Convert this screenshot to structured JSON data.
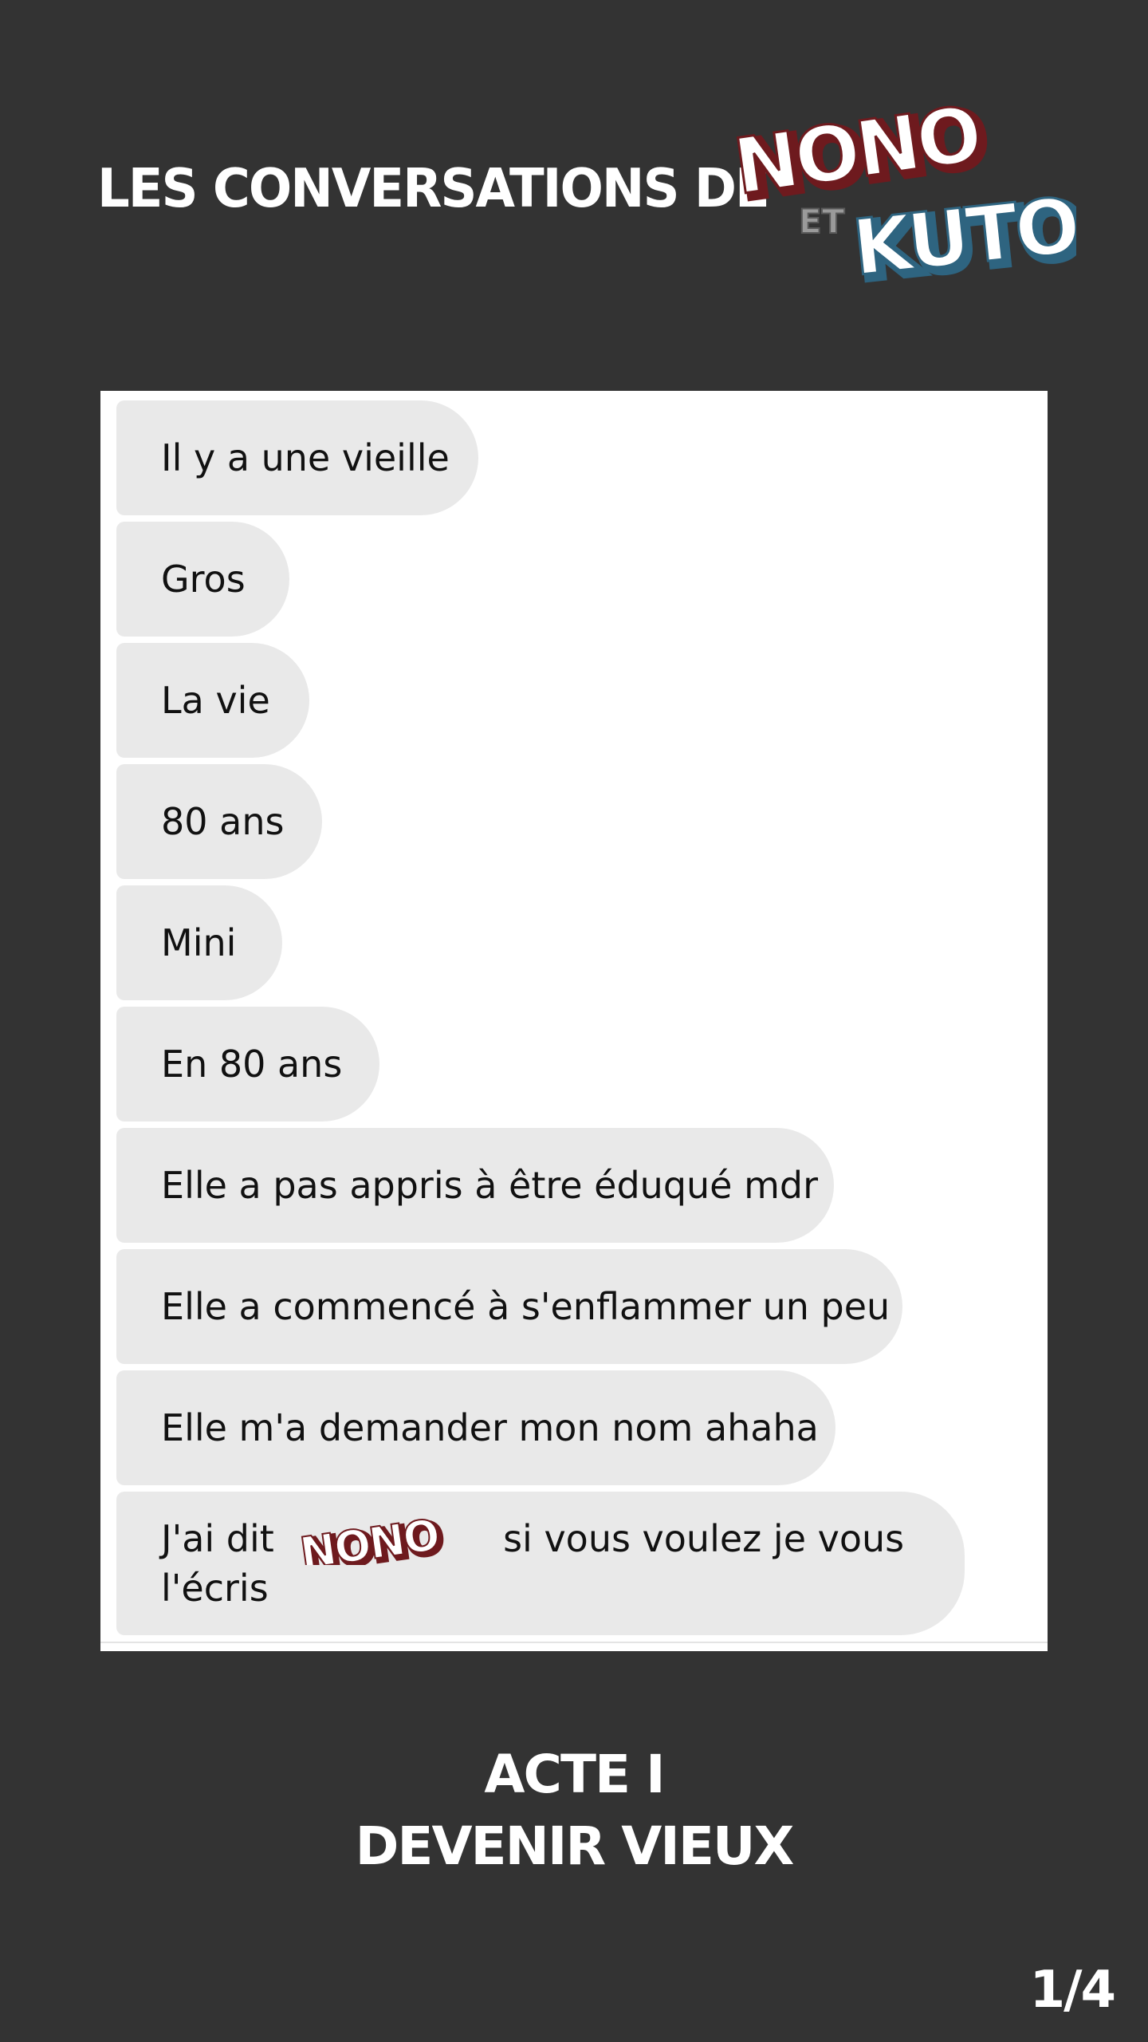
{
  "header": {
    "title": "LES CONVERSATIONS DE",
    "logo": {
      "line1": "NONO",
      "connector": "ET",
      "line2": "KUTO",
      "color_nono": "#ffffff",
      "color_nono_shadow": "#6e1a1e",
      "color_kuto_shadow": "#2e6480",
      "color_et": "#9a9a9a"
    }
  },
  "chat": {
    "messages": [
      {
        "text": "Il y a une vieille"
      },
      {
        "text": "Gros"
      },
      {
        "text": "La vie"
      },
      {
        "text": "80 ans"
      },
      {
        "text": "Mini"
      },
      {
        "text": "En 80 ans"
      },
      {
        "text": "Elle a pas appris à être éduqué mdr"
      },
      {
        "text": "Elle a commencé à s'enflammer un peu"
      },
      {
        "text": "Elle m'a demander mon nom ahaha"
      }
    ],
    "last_message": {
      "part1": "J'ai dit",
      "inline_logo": "NONO",
      "part2": "si vous voulez je vous l'écris"
    }
  },
  "act": {
    "line1": "ACTE I",
    "line2": "DEVENIR VIEUX"
  },
  "page": "1/4"
}
